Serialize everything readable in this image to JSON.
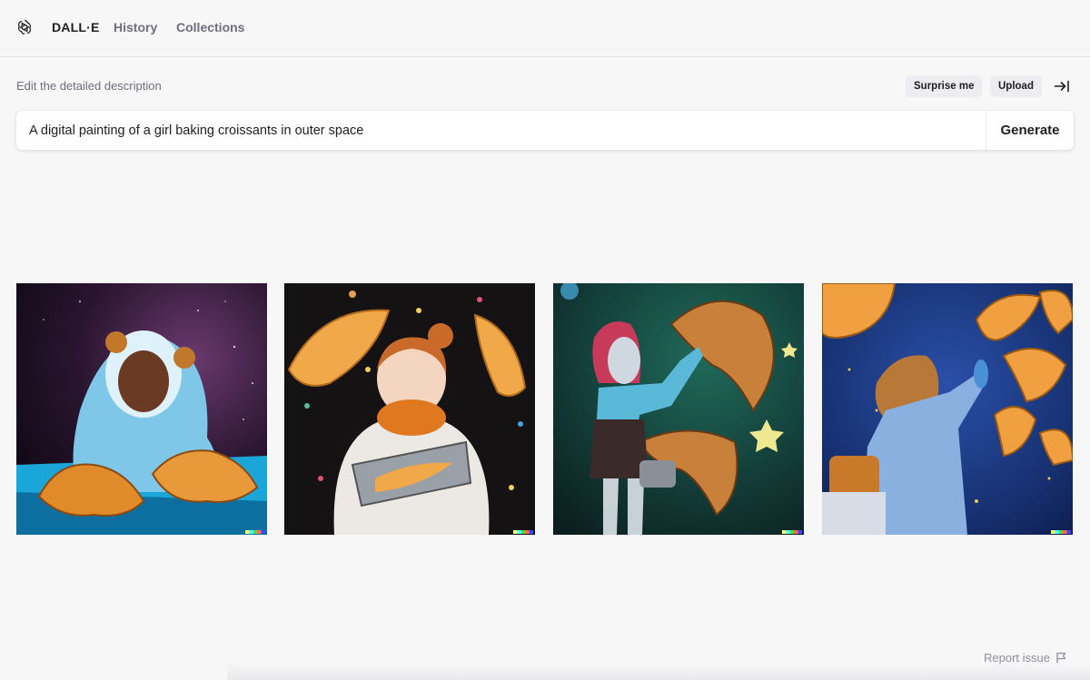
{
  "nav": {
    "brand": "DALL·E",
    "history": "History",
    "collections": "Collections"
  },
  "editor": {
    "hint": "Edit the detailed description",
    "surprise_label": "Surprise me",
    "upload_label": "Upload",
    "prompt_value": "A digital painting of a girl baking croissants in outer space",
    "generate_label": "Generate"
  },
  "results": [
    {
      "description": "girl in blue astronaut hood with croissants in space"
    },
    {
      "description": "girl with orange scarf holding tray of croissants"
    },
    {
      "description": "girl with red hair reaching for floating croissant"
    },
    {
      "description": "girl with ponytail among floating croissants in blue space"
    }
  ],
  "footer": {
    "report_label": "Report issue"
  },
  "icons": {
    "logo": "openai-logo-icon",
    "collapse": "collapse-panel-icon",
    "report": "flag-icon"
  },
  "colors": {
    "background": "#f7f7f8",
    "text": "#202123",
    "muted": "#6e6e80",
    "button_bg": "#ececf1"
  }
}
